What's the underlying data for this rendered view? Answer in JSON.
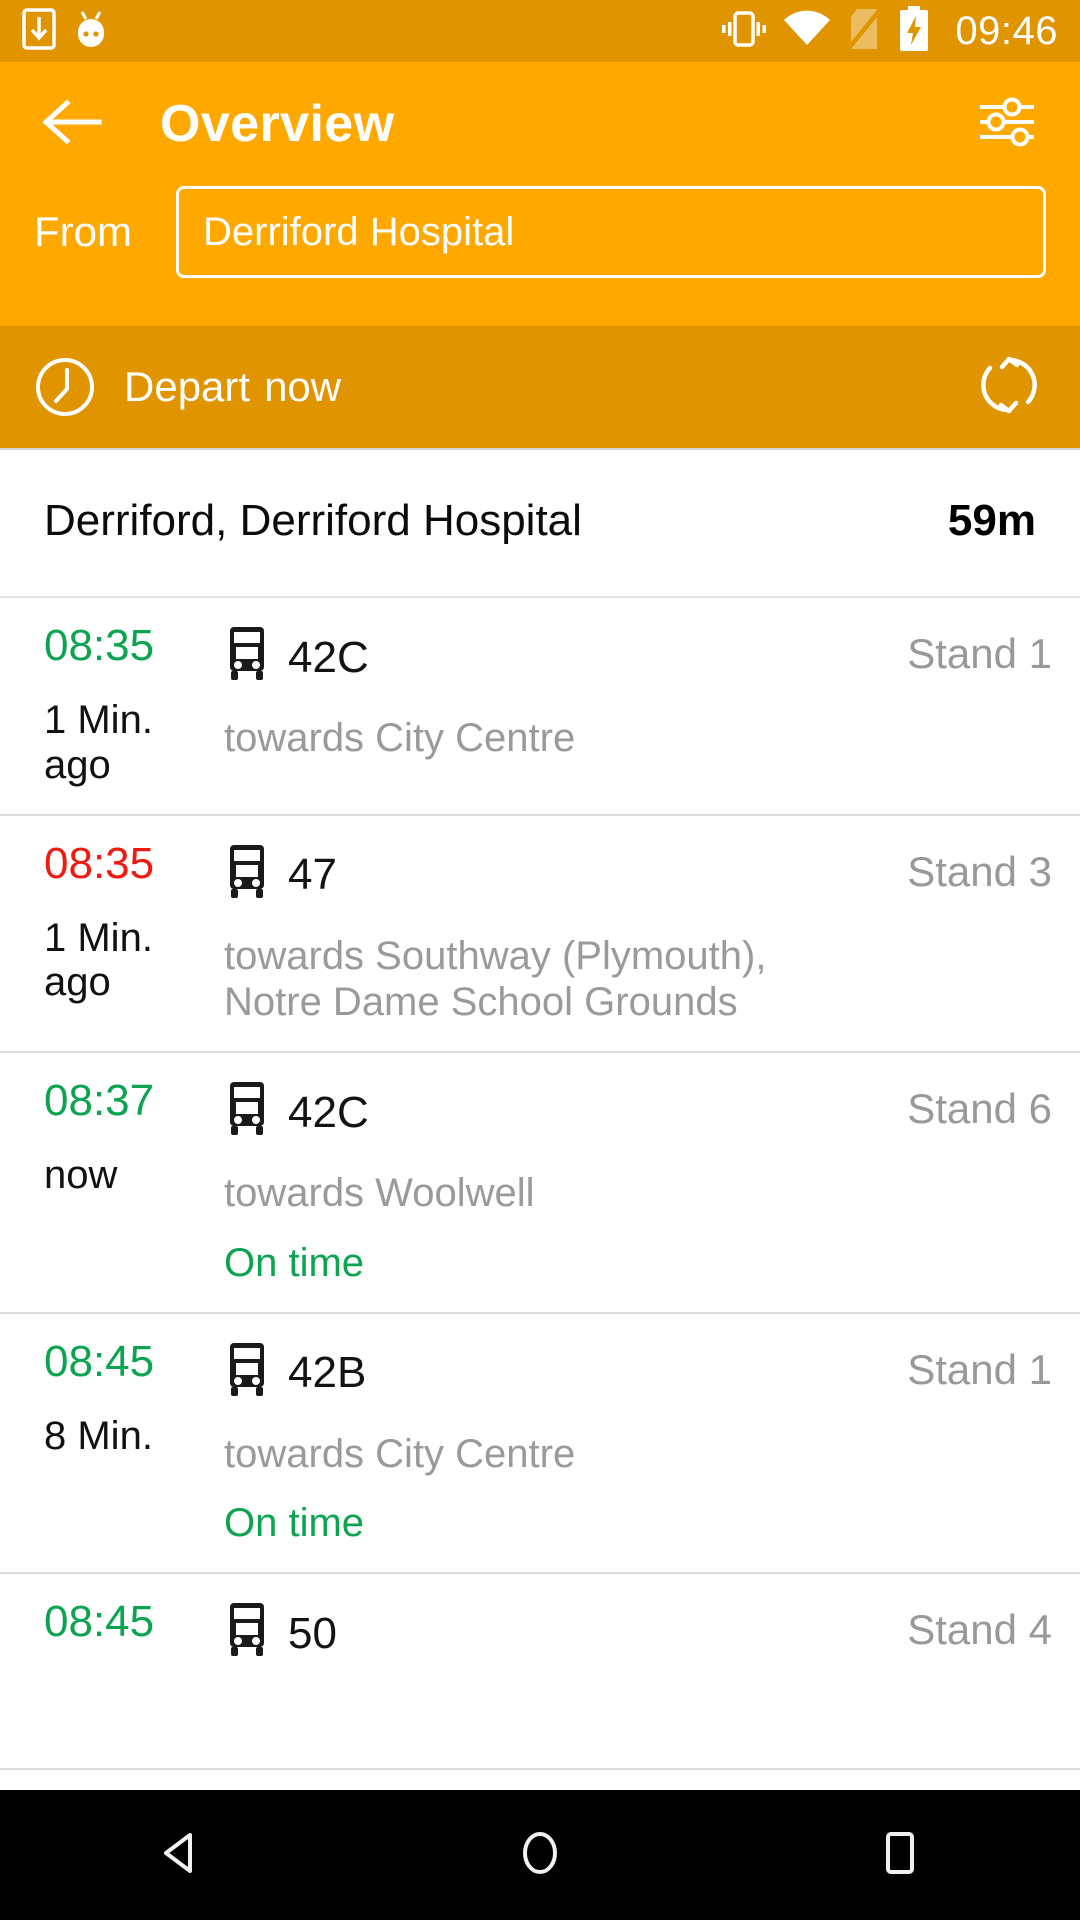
{
  "statusbar": {
    "time": "09:46",
    "icons": [
      "download-icon",
      "android-icon",
      "vibrate-icon",
      "wifi-icon",
      "no-sim-icon",
      "battery-charging-icon"
    ]
  },
  "appbar": {
    "back_icon": "back-arrow-icon",
    "title": "Overview",
    "filter_icon": "settings-sliders-icon"
  },
  "search": {
    "from_label": "From",
    "from_value": "Derriford Hospital",
    "from_placeholder": "From"
  },
  "departbar": {
    "clock_icon": "clock-icon",
    "depart_word": "Depart",
    "depart_when": "now",
    "refresh_icon": "refresh-icon"
  },
  "stop": {
    "name": "Derriford, Derriford Hospital",
    "distance": "59m"
  },
  "departures": [
    {
      "time": "08:35",
      "time_color": "green",
      "countdown": "1 Min. ago",
      "vehicle_icon": "double-decker-bus-icon",
      "route": "42C",
      "towards": "towards City Centre",
      "status": "",
      "stand": "Stand 1"
    },
    {
      "time": "08:35",
      "time_color": "red",
      "countdown": "1 Min. ago",
      "vehicle_icon": "double-decker-bus-icon",
      "route": "47",
      "towards": "towards Southway (Plymouth), Notre Dame School Grounds",
      "status": "",
      "stand": "Stand 3"
    },
    {
      "time": "08:37",
      "time_color": "green",
      "countdown": "now",
      "vehicle_icon": "double-decker-bus-icon",
      "route": "42C",
      "towards": "towards Woolwell",
      "status": "On time",
      "stand": "Stand 6"
    },
    {
      "time": "08:45",
      "time_color": "green",
      "countdown": "8 Min.",
      "vehicle_icon": "double-decker-bus-icon",
      "route": "42B",
      "towards": "towards City Centre",
      "status": "On time",
      "stand": "Stand 1"
    },
    {
      "time": "08:45",
      "time_color": "green",
      "countdown": "",
      "vehicle_icon": "double-decker-bus-icon",
      "route": "50",
      "towards": "",
      "status": "",
      "stand": "Stand 4"
    }
  ],
  "navbar": {
    "back_icon": "nav-back-icon",
    "home_icon": "nav-home-icon",
    "recents_icon": "nav-recents-icon"
  },
  "colors": {
    "status_bar": "#e09400",
    "app_bar": "#ffa800",
    "depart_bar": "#e09400",
    "on_time_green": "#0ca450",
    "late_red": "#ef1b12",
    "muted_gray": "#9a9a9a"
  }
}
